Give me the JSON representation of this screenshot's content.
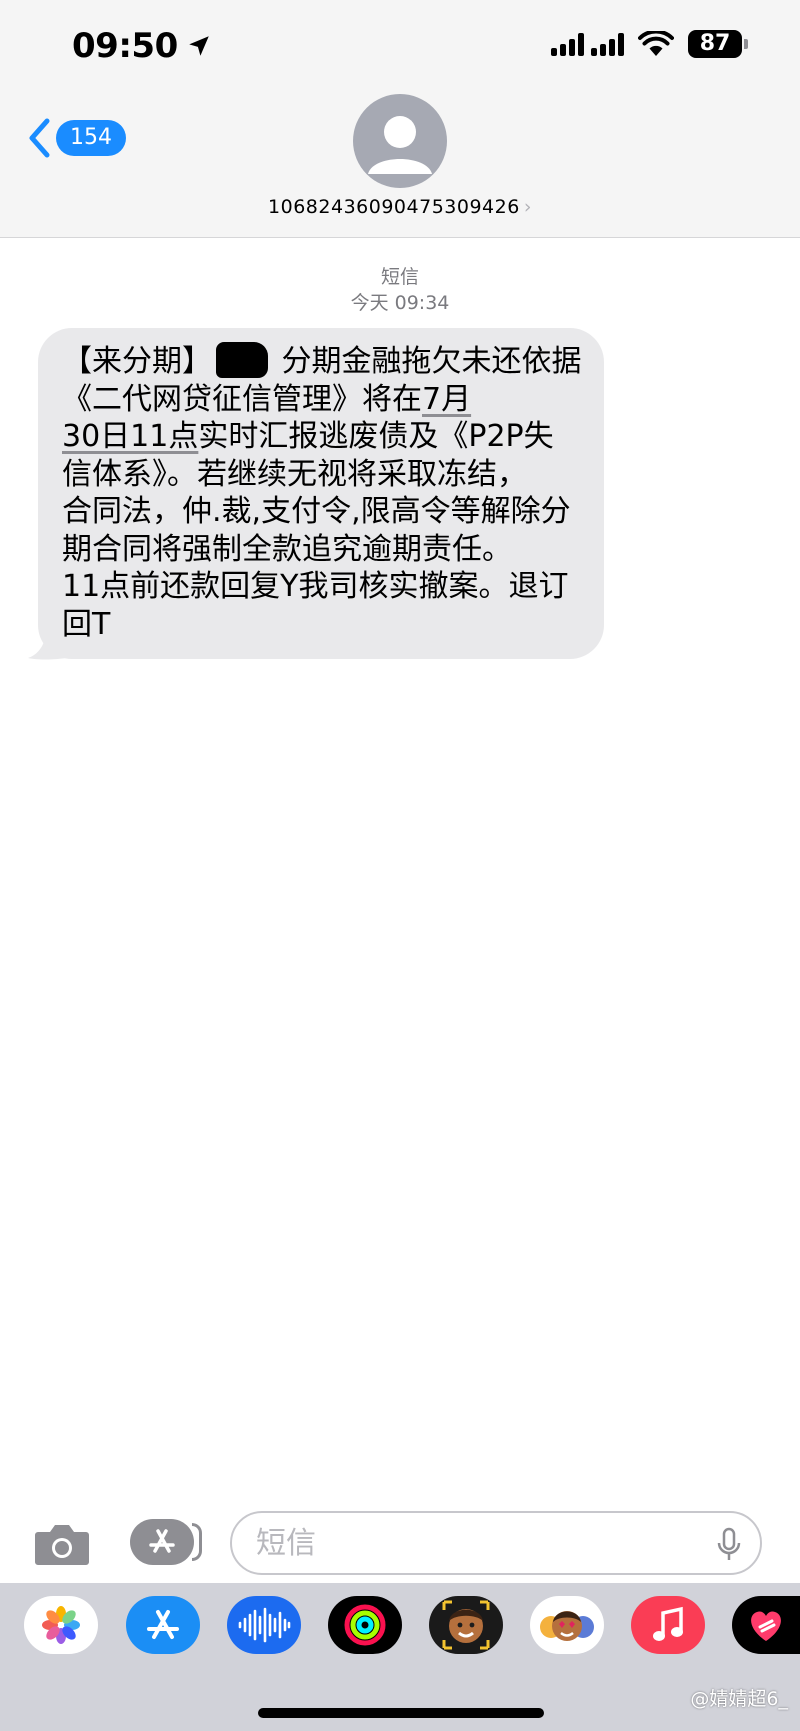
{
  "status_bar": {
    "time": "09:50",
    "battery": "87"
  },
  "header": {
    "back_count": "154",
    "contact": "10682436090475309426"
  },
  "conversation": {
    "label": "短信",
    "timestamp": "今天 09:34",
    "message": {
      "seg1": "【来分期】",
      "seg2": " 分期金融拖欠未还依据《二代网贷征信管理》将在",
      "link": "7月\n30日11点",
      "seg3": "实时汇报逃废债及《P2P失信体系》。若继续无视将采取冻结，\n合同法，仲.裁,支付令,限高令等解除分期合同将强制全款追究逾期责任。\n11点前还款回复Y我司核实撤案。退订回T"
    }
  },
  "input": {
    "placeholder": "短信"
  },
  "watermark": "@婧婧超6_",
  "apps": [
    "photos-app",
    "app-store-app",
    "audio-message-app",
    "activity-app",
    "memoji-app",
    "memoji-stickers-app",
    "music-app",
    "digital-touch-app"
  ],
  "colors": {
    "accent": "#1a8cff",
    "bubble": "#e9e9eb",
    "header_bg": "#f5f5f5",
    "drawer_bg": "#d1d2d9"
  }
}
